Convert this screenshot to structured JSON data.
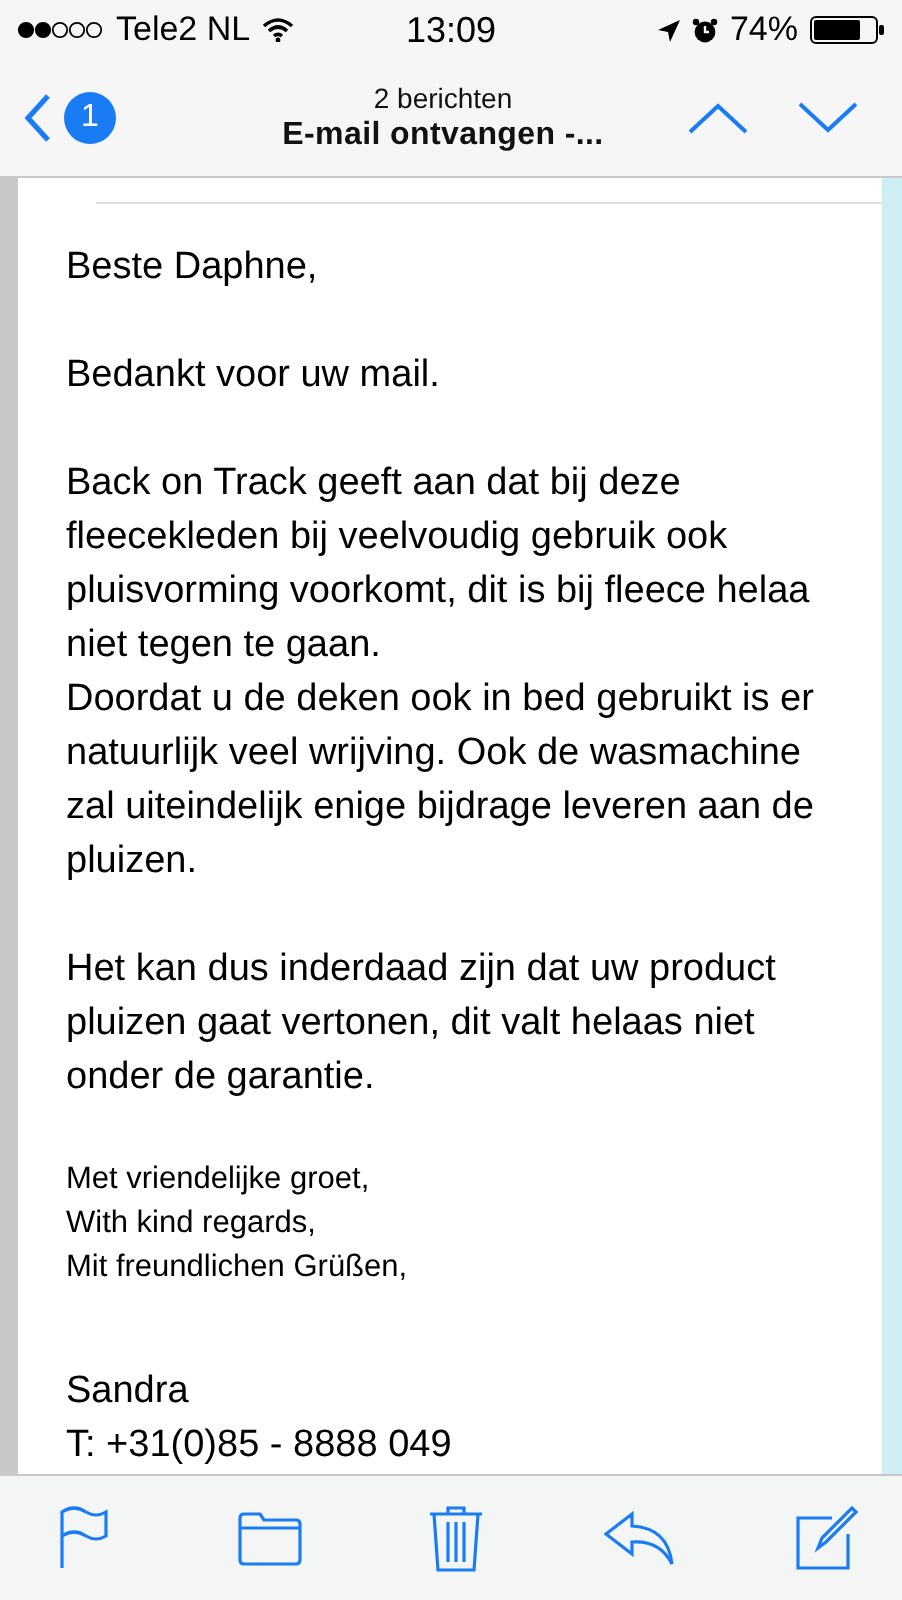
{
  "status_bar": {
    "carrier": "Tele2 NL",
    "time": "13:09",
    "battery": "74%"
  },
  "nav": {
    "badge": "1",
    "subtitle": "2 berichten",
    "title": "E-mail ontvangen -..."
  },
  "body": [
    {
      "kind": "text",
      "lines": [
        "Beste Daphne,"
      ]
    },
    {
      "kind": "text",
      "lines": [
        "Bedankt voor uw mail."
      ]
    },
    {
      "kind": "text",
      "lines": [
        "Back on Track geeft aan dat bij deze",
        "fleecekleden bij veelvoudig gebruik ook",
        "pluisvorming voorkomt, dit is bij fleece helaa",
        "niet tegen te gaan.",
        "Doordat u de deken ook in bed gebruikt is er",
        "natuurlijk veel wrijving. Ook de wasmachine",
        "zal uiteindelijk enige bijdrage leveren aan de",
        "pluizen."
      ]
    },
    {
      "kind": "text",
      "lines": [
        "Het kan dus inderdaad zijn dat uw product",
        "pluizen gaat vertonen, dit valt helaas niet",
        "onder de garantie."
      ]
    },
    {
      "kind": "signature",
      "lines": [
        "Met vriendelijke groet,",
        "With kind regards,",
        "Mit freundlichen Grüßen,"
      ]
    },
    {
      "kind": "text",
      "lines": [
        "Sandra",
        "T: +31(0)85 - 8888 049"
      ]
    }
  ]
}
